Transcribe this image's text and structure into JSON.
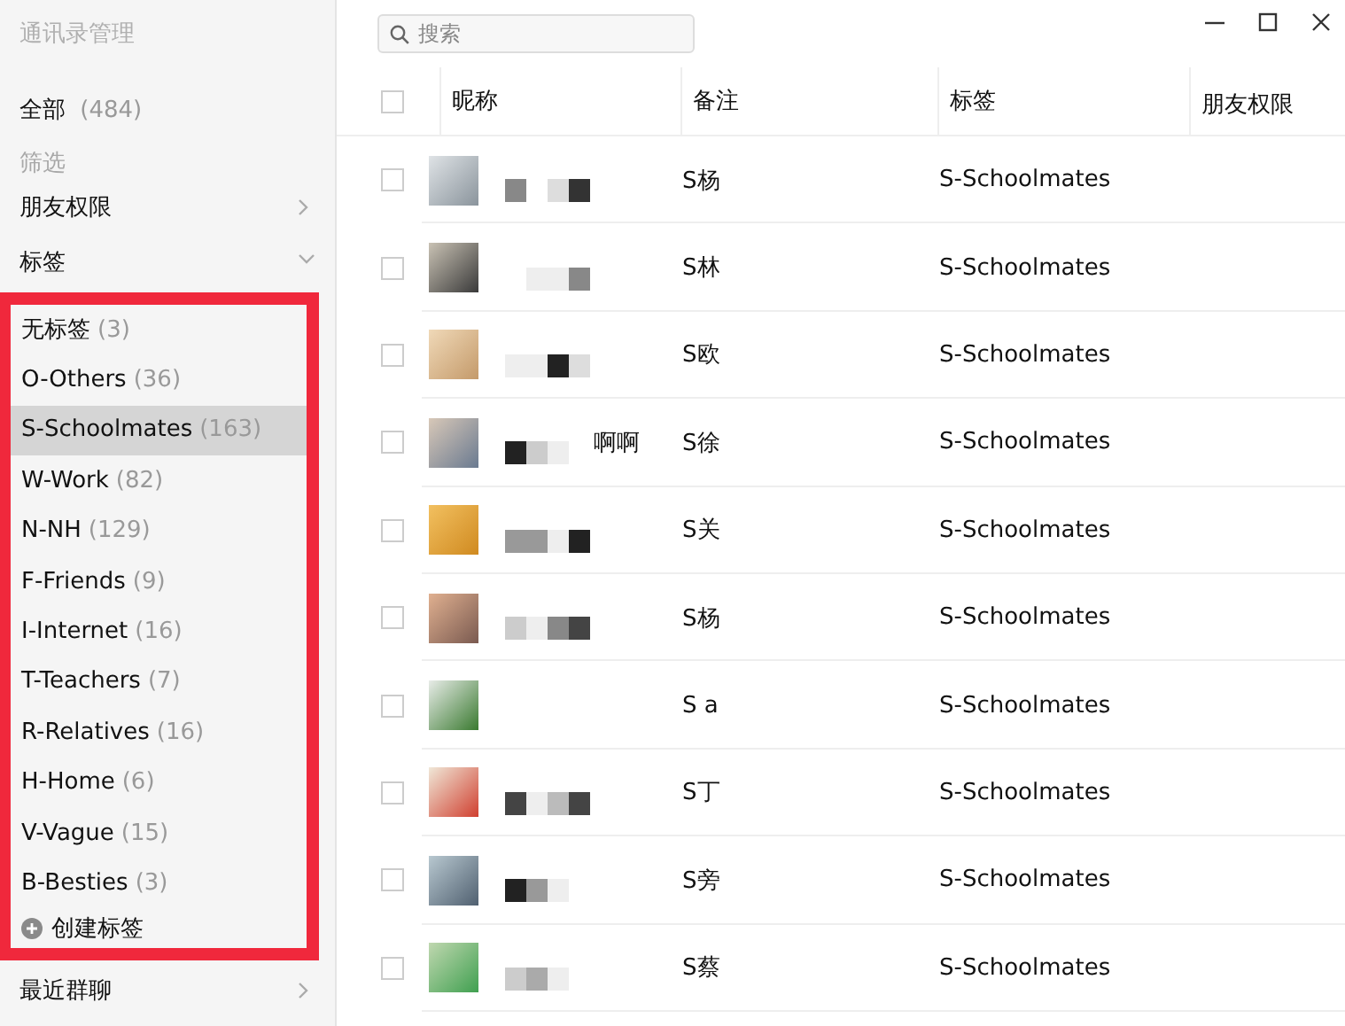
{
  "sidebar": {
    "title": "通讯录管理",
    "all": {
      "label": "全部",
      "count": "(484)"
    },
    "filter_heading": "筛选",
    "sections": [
      {
        "label": "朋友权限",
        "expanded": false
      },
      {
        "label": "标签",
        "expanded": true
      }
    ],
    "tags": {
      "highlighted": true,
      "items": [
        {
          "name": "无标签",
          "count": "(3)",
          "selected": false
        },
        {
          "name": "O-Others",
          "count": "(36)",
          "selected": false
        },
        {
          "name": "S-Schoolmates",
          "count": "(163)",
          "selected": true
        },
        {
          "name": "W-Work",
          "count": "(82)",
          "selected": false
        },
        {
          "name": "N-NH",
          "count": "(129)",
          "selected": false
        },
        {
          "name": "F-Friends",
          "count": "(9)",
          "selected": false
        },
        {
          "name": "I-Internet",
          "count": "(16)",
          "selected": false
        },
        {
          "name": "T-Teachers",
          "count": "(7)",
          "selected": false
        },
        {
          "name": "R-Relatives",
          "count": "(16)",
          "selected": false
        },
        {
          "name": "H-Home",
          "count": "(6)",
          "selected": false
        },
        {
          "name": "V-Vague",
          "count": "(15)",
          "selected": false
        },
        {
          "name": "B-Besties",
          "count": "(3)",
          "selected": false
        }
      ],
      "create_label": "创建标签"
    },
    "recent_groups": {
      "label": "最近群聊",
      "expanded": false
    }
  },
  "search": {
    "placeholder": "搜索"
  },
  "table": {
    "all_checked": false,
    "columns": [
      "昵称",
      "备注",
      "标签",
      "朋友权限"
    ],
    "rows": [
      {
        "checked": false,
        "nickname": "",
        "remark": "S杨",
        "tag": "S-Schoolmates"
      },
      {
        "checked": false,
        "nickname": "",
        "remark": "S林",
        "tag": "S-Schoolmates"
      },
      {
        "checked": false,
        "nickname": "",
        "remark": "S欧",
        "tag": "S-Schoolmates"
      },
      {
        "checked": false,
        "nickname": "啊啊",
        "remark": "S徐",
        "tag": "S-Schoolmates"
      },
      {
        "checked": false,
        "nickname": "",
        "remark": "S关",
        "tag": "S-Schoolmates"
      },
      {
        "checked": false,
        "nickname": "",
        "remark": "S杨",
        "tag": "S-Schoolmates"
      },
      {
        "checked": false,
        "nickname": "",
        "remark": "S a",
        "tag": "S-Schoolmates"
      },
      {
        "checked": false,
        "nickname": "",
        "remark": "S丁",
        "tag": "S-Schoolmates"
      },
      {
        "checked": false,
        "nickname": "",
        "remark": "S旁",
        "tag": "S-Schoolmates"
      },
      {
        "checked": false,
        "nickname": "",
        "remark": "S蔡",
        "tag": "S-Schoolmates"
      }
    ]
  }
}
